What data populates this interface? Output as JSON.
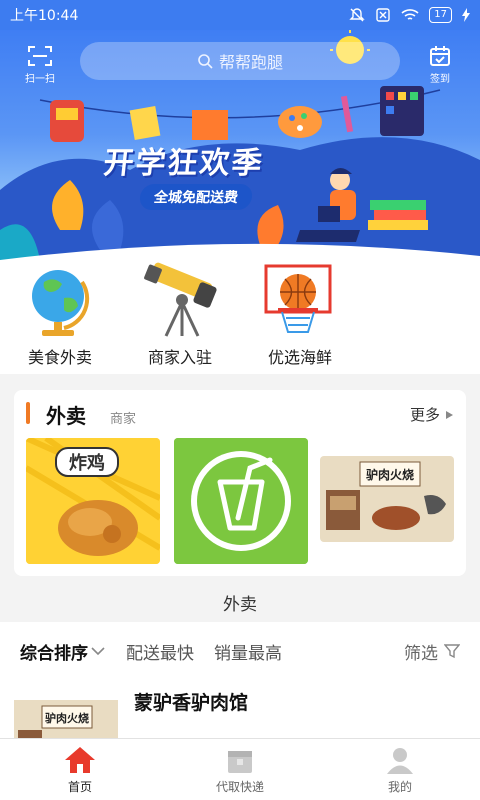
{
  "status_bar": {
    "time": "上午10:44",
    "battery": "17"
  },
  "header": {
    "scan_label": "扫一扫",
    "search_placeholder": "帮帮跑腿",
    "checkin_label": "签到"
  },
  "banner": {
    "title": "开学狂欢季",
    "subtitle": "全城免配送费"
  },
  "categories": [
    {
      "label": "美食外卖",
      "icon": "globe-icon"
    },
    {
      "label": "商家入驻",
      "icon": "telescope-icon"
    },
    {
      "label": "优选海鲜",
      "icon": "basketball-icon"
    }
  ],
  "section": {
    "title": "外卖",
    "subtitle": "商家",
    "more_label": "更多",
    "thumbnails": [
      {
        "name": "fried-chicken",
        "text": "炸鸡"
      },
      {
        "name": "drink-logo"
      },
      {
        "name": "donkey-meat",
        "text": "驴肉火烧"
      }
    ],
    "caption": "外卖"
  },
  "sort": {
    "items": [
      "综合排序",
      "配送最快",
      "销量最高"
    ],
    "filter_label": "筛选"
  },
  "shop": {
    "name": "蒙驴香驴肉馆",
    "thumb_text": "驴肉火烧"
  },
  "nav": [
    {
      "label": "首页",
      "icon": "home-icon"
    },
    {
      "label": "代取快递",
      "icon": "package-icon"
    },
    {
      "label": "我的",
      "icon": "user-icon"
    }
  ],
  "colors": {
    "primary": "#3d7cf0",
    "accent": "#f07a24",
    "active_nav": "#e83a2c"
  }
}
